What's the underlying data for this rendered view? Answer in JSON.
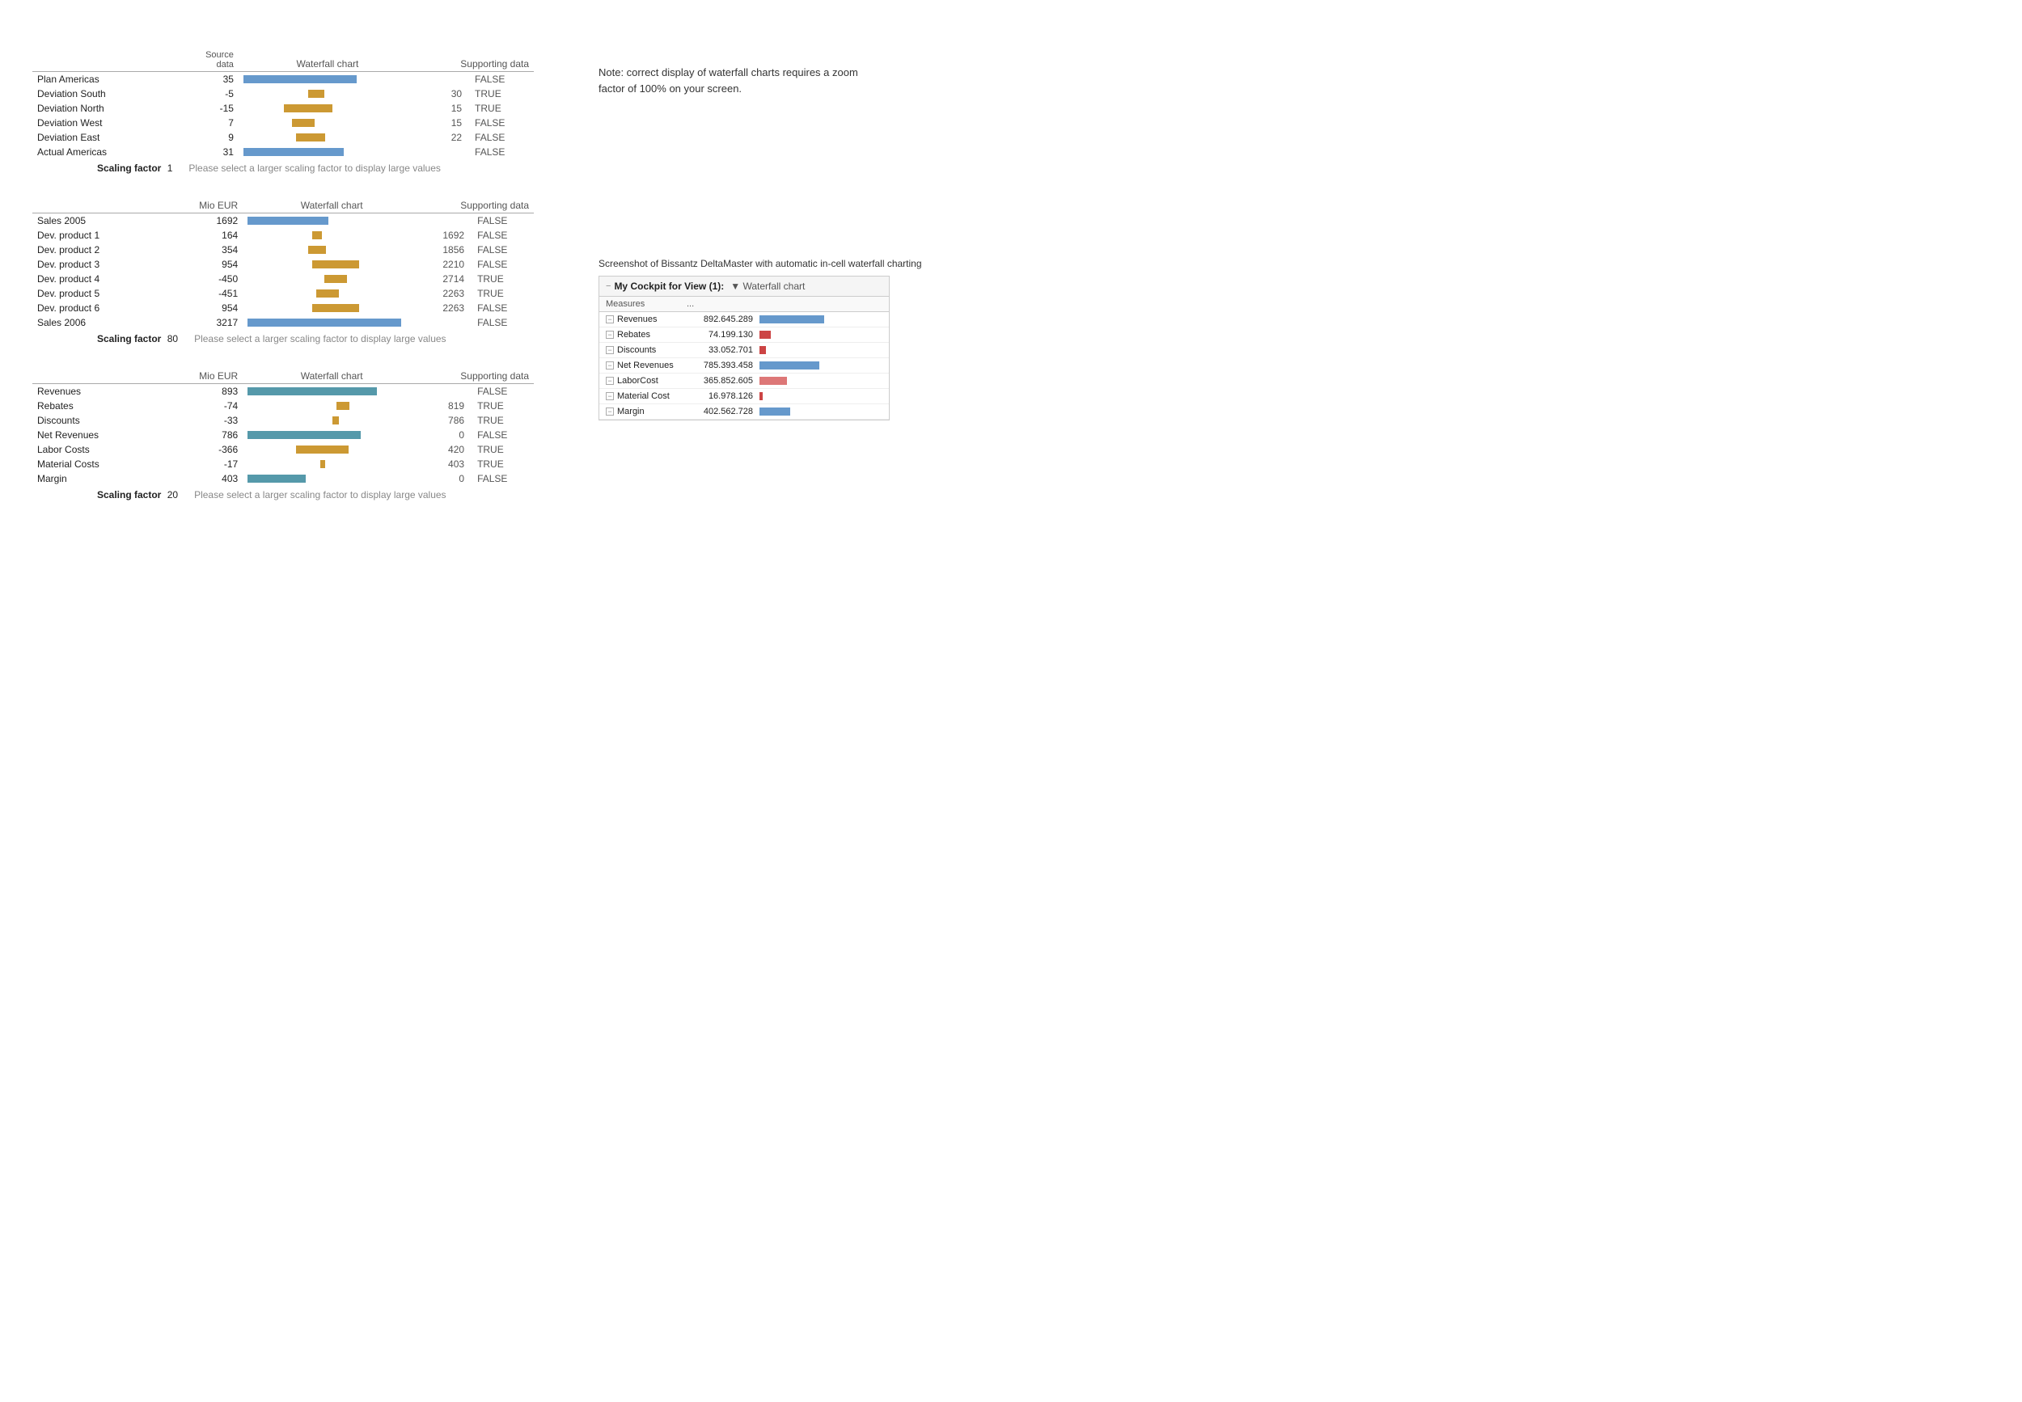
{
  "tables": [
    {
      "id": "table1",
      "headers": {
        "col1": "",
        "col2_line1": "Source",
        "col2_line2": "data",
        "col3": "Waterfall chart",
        "col4": "Supporting data"
      },
      "rows": [
        {
          "label": "Plan Americas",
          "indent": false,
          "value": "35",
          "barType": "blue",
          "barWidth": 140,
          "barOffset": 0,
          "supportVal": "",
          "boolVal": "FALSE"
        },
        {
          "label": "Deviation South",
          "indent": true,
          "value": "-5",
          "barType": "gold",
          "barWidth": 20,
          "barOffset": 80,
          "supportVal": "30",
          "boolVal": "TRUE"
        },
        {
          "label": "Deviation North",
          "indent": true,
          "value": "-15",
          "barType": "gold",
          "barWidth": 60,
          "barOffset": 50,
          "supportVal": "15",
          "boolVal": "TRUE"
        },
        {
          "label": "Deviation West",
          "indent": true,
          "value": "7",
          "barType": "gold",
          "barWidth": 28,
          "barOffset": 60,
          "supportVal": "15",
          "boolVal": "FALSE"
        },
        {
          "label": "Deviation East",
          "indent": true,
          "value": "9",
          "barType": "gold",
          "barWidth": 36,
          "barOffset": 65,
          "supportVal": "22",
          "boolVal": "FALSE"
        },
        {
          "label": "Actual Americas",
          "indent": false,
          "value": "31",
          "barType": "blue",
          "barWidth": 124,
          "barOffset": 0,
          "supportVal": "",
          "boolVal": "FALSE"
        }
      ],
      "scalingFactor": "1",
      "scalingNote": "Please select a larger scaling factor to display large values"
    },
    {
      "id": "table2",
      "headers": {
        "col1": "",
        "col2": "Mio EUR",
        "col3": "Waterfall chart",
        "col4": "Supporting data"
      },
      "rows": [
        {
          "label": "Sales 2005",
          "indent": false,
          "value": "1692",
          "barType": "blue",
          "barWidth": 100,
          "barOffset": 0,
          "supportVal": "",
          "boolVal": "FALSE"
        },
        {
          "label": "Dev. product 1",
          "indent": true,
          "value": "164",
          "barType": "gold",
          "barWidth": 12,
          "barOffset": 80,
          "supportVal": "1692",
          "boolVal": "FALSE"
        },
        {
          "label": "Dev. product 2",
          "indent": true,
          "value": "354",
          "barType": "gold",
          "barWidth": 22,
          "barOffset": 75,
          "supportVal": "1856",
          "boolVal": "FALSE"
        },
        {
          "label": "Dev. product 3",
          "indent": true,
          "value": "954",
          "barType": "gold",
          "barWidth": 58,
          "barOffset": 80,
          "supportVal": "2210",
          "boolVal": "FALSE"
        },
        {
          "label": "Dev. product 4",
          "indent": true,
          "value": "-450",
          "barType": "gold",
          "barWidth": 28,
          "barOffset": 95,
          "supportVal": "2714",
          "boolVal": "TRUE"
        },
        {
          "label": "Dev. product 5",
          "indent": true,
          "value": "-451",
          "barType": "gold",
          "barWidth": 28,
          "barOffset": 85,
          "supportVal": "2263",
          "boolVal": "TRUE"
        },
        {
          "label": "Dev. product 6",
          "indent": true,
          "value": "954",
          "barType": "gold",
          "barWidth": 58,
          "barOffset": 80,
          "supportVal": "2263",
          "boolVal": "FALSE"
        },
        {
          "label": "Sales 2006",
          "indent": false,
          "value": "3217",
          "barType": "blue",
          "barWidth": 190,
          "barOffset": 0,
          "supportVal": "",
          "boolVal": "FALSE"
        }
      ],
      "scalingFactor": "80",
      "scalingNote": "Please select a larger scaling factor to display large values"
    },
    {
      "id": "table3",
      "headers": {
        "col1": "",
        "col2": "Mio EUR",
        "col3": "Waterfall chart",
        "col4": "Supporting data"
      },
      "rows": [
        {
          "label": "Revenues",
          "indent": false,
          "value": "893",
          "barType": "teal",
          "barWidth": 160,
          "barOffset": 0,
          "supportVal": "",
          "boolVal": "FALSE"
        },
        {
          "label": "Rebates",
          "indent": true,
          "value": "-74",
          "barType": "gold",
          "barWidth": 16,
          "barOffset": 110,
          "supportVal": "819",
          "boolVal": "TRUE"
        },
        {
          "label": "Discounts",
          "indent": true,
          "value": "-33",
          "barType": "gold",
          "barWidth": 8,
          "barOffset": 105,
          "supportVal": "786",
          "boolVal": "TRUE"
        },
        {
          "label": "Net Revenues",
          "indent": false,
          "value": "786",
          "barType": "teal",
          "barWidth": 140,
          "barOffset": 0,
          "supportVal": "0",
          "boolVal": "FALSE"
        },
        {
          "label": "Labor Costs",
          "indent": true,
          "value": "-366",
          "barType": "gold",
          "barWidth": 65,
          "barOffset": 60,
          "supportVal": "420",
          "boolVal": "TRUE"
        },
        {
          "label": "Material Costs",
          "indent": true,
          "value": "-17",
          "barType": "gold",
          "barWidth": 6,
          "barOffset": 90,
          "supportVal": "403",
          "boolVal": "TRUE"
        },
        {
          "label": "Margin",
          "indent": false,
          "value": "403",
          "barType": "teal",
          "barWidth": 72,
          "barOffset": 0,
          "supportVal": "0",
          "boolVal": "FALSE"
        }
      ],
      "scalingFactor": "20",
      "scalingNote": "Please select a larger scaling factor to display large values"
    }
  ],
  "note": {
    "text": "Note: correct display of waterfall charts requires a zoom factor of 100% on your screen."
  },
  "screenshot": {
    "label": "Screenshot of Bissantz DeltaMaster with automatic in-cell waterfall charting",
    "cockpit": {
      "title": "My Cockpit for View (1):",
      "subtitle": "▼ Waterfall chart",
      "colHeaders": [
        "Measures",
        "..."
      ],
      "rows": [
        {
          "label": "Revenues",
          "value": "892.645.289",
          "barType": "blue",
          "barWidth": 80
        },
        {
          "label": "Rebates",
          "value": "74.199.130",
          "barType": "red",
          "barWidth": 14
        },
        {
          "label": "Discounts",
          "value": "33.052.701",
          "barType": "red",
          "barWidth": 8
        },
        {
          "label": "Net Revenues",
          "value": "785.393.458",
          "barType": "blue",
          "barWidth": 74
        },
        {
          "label": "LaborCost",
          "value": "365.852.605",
          "barType": "pink",
          "barWidth": 34
        },
        {
          "label": "Material Cost",
          "value": "16.978.126",
          "barType": "red",
          "barWidth": 4
        },
        {
          "label": "Margin",
          "value": "402.562.728",
          "barType": "blue",
          "barWidth": 38
        }
      ]
    }
  },
  "scaling": {
    "label": "Scaling factor"
  }
}
